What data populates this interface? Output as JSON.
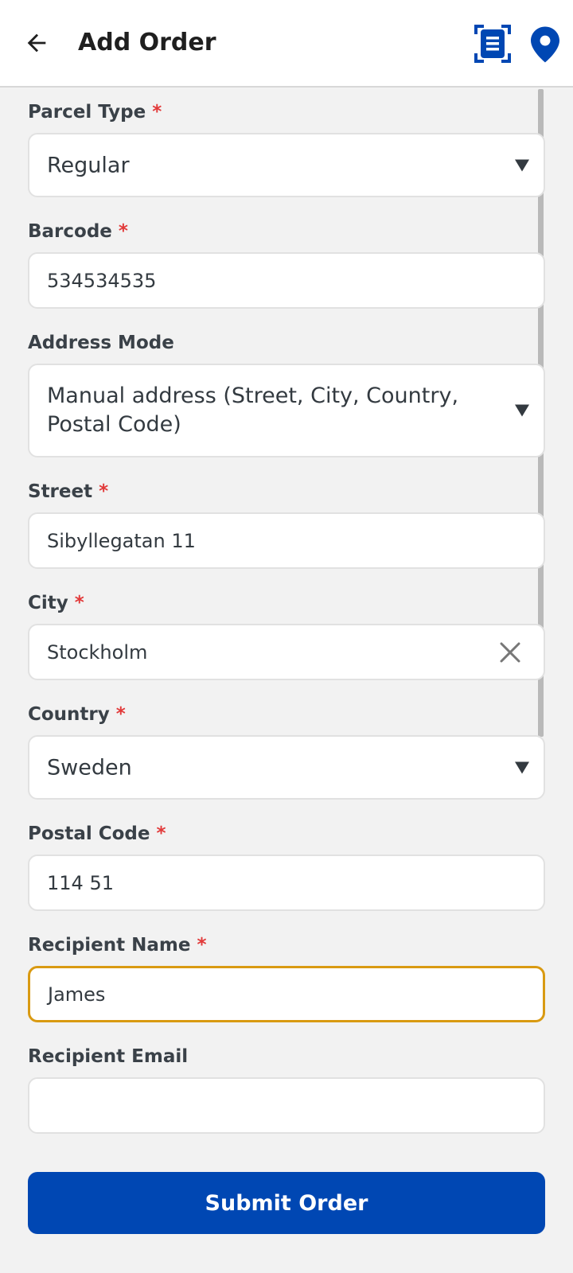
{
  "header": {
    "title": "Add Order",
    "back_icon": "arrow-left-icon",
    "scan_icon": "barcode-scan-icon",
    "location_icon": "map-pin-icon",
    "accent_color": "#0047b3"
  },
  "form": {
    "required_marker": "*",
    "parcel_type": {
      "label": "Parcel Type",
      "value": "Regular"
    },
    "barcode": {
      "label": "Barcode",
      "value": "534534535"
    },
    "address_mode": {
      "label": "Address Mode",
      "value": "Manual address (Street, City, Country, Postal Code)"
    },
    "street": {
      "label": "Street",
      "value": "Sibyllegatan 11"
    },
    "city": {
      "label": "City",
      "value": "Stockholm"
    },
    "country": {
      "label": "Country",
      "value": "Sweden"
    },
    "postal_code": {
      "label": "Postal Code",
      "value": "114 51"
    },
    "recipient_name": {
      "label": "Recipient Name",
      "value": "James"
    },
    "recipient_email": {
      "label": "Recipient Email",
      "value": ""
    }
  },
  "actions": {
    "submit_label": "Submit Order"
  },
  "colors": {
    "required": "#e23a3a",
    "focus_border": "#d99a12",
    "primary_button": "#0047b3"
  }
}
